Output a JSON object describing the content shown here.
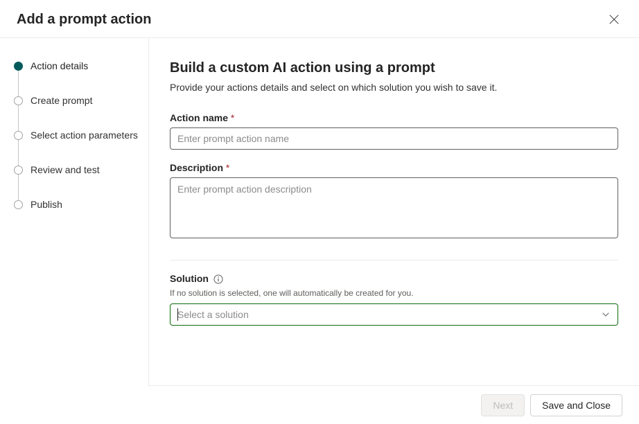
{
  "header": {
    "title": "Add a prompt action"
  },
  "sidebar": {
    "steps": [
      {
        "label": "Action details",
        "active": true
      },
      {
        "label": "Create prompt",
        "active": false
      },
      {
        "label": "Select action parameters",
        "active": false
      },
      {
        "label": "Review and test",
        "active": false
      },
      {
        "label": "Publish",
        "active": false
      }
    ]
  },
  "main": {
    "title": "Build a custom AI action using a prompt",
    "subtitle": "Provide your actions details and select on which solution you wish to save it.",
    "action_name": {
      "label": "Action name",
      "required": "*",
      "placeholder": "Enter prompt action name",
      "value": ""
    },
    "description": {
      "label": "Description",
      "required": "*",
      "placeholder": "Enter prompt action description",
      "value": ""
    },
    "solution": {
      "label": "Solution",
      "helper": "If no solution is selected, one will automatically be created for you.",
      "placeholder": "Select a solution"
    }
  },
  "footer": {
    "next": "Next",
    "save_close": "Save and Close"
  }
}
